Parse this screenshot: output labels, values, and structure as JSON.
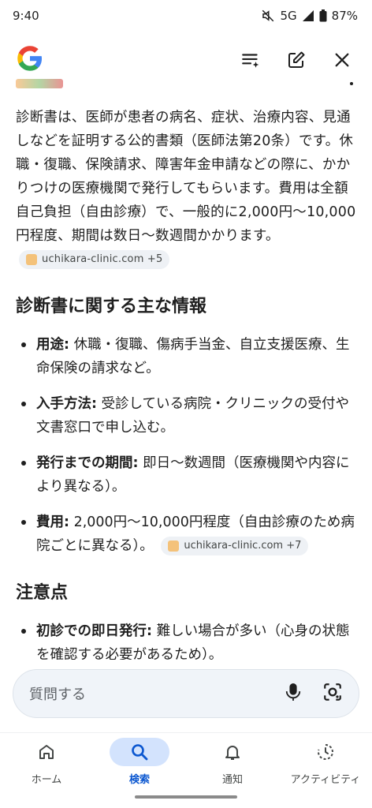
{
  "status": {
    "time": "9:40",
    "network": "5G",
    "battery": "87%"
  },
  "app": {
    "logo": "G"
  },
  "answer": {
    "intro": "診断書は、医師が患者の病名、症状、治療内容、見通しなどを証明する公的書類（医師法第20条）です。休職・復職、保険請求、障害年金申請などの際に、かかりつけの医療機関で発行してもらいます。費用は全額自己負担（自由診療）で、一般的に2,000円〜10,000円程度、期間は数日〜数週間かかります。",
    "intro_source": "uchikara-clinic.com +5",
    "section1_title": "診断書に関する主な情報",
    "items1": [
      {
        "term": "用途:",
        "text": " 休職・復職、傷病手当金、自立支援医療、生命保険の請求など。"
      },
      {
        "term": "入手方法:",
        "text": " 受診している病院・クリニックの受付や文書窓口で申し込む。"
      },
      {
        "term": "発行までの期間:",
        "text": " 即日〜数週間（医療機関や内容により異なる）。"
      },
      {
        "term": "費用:",
        "text": " 2,000円〜10,000円程度（自由診療のため病院ごとに異なる）。"
      }
    ],
    "items1_source": "uchikara-clinic.com +7",
    "section2_title": "注意点",
    "items2": [
      {
        "term": "初診での即日発行:",
        "text": " 難しい場合が多い（心身の状態を確認する必要があるため）。"
      }
    ]
  },
  "search": {
    "placeholder": "質問する"
  },
  "nav": [
    {
      "label": "ホーム",
      "icon": "home-icon",
      "active": false
    },
    {
      "label": "検索",
      "icon": "search-icon",
      "active": true
    },
    {
      "label": "通知",
      "icon": "bell-icon",
      "active": false
    },
    {
      "label": "アクティビティ",
      "icon": "activity-icon",
      "active": false
    }
  ],
  "colors": {
    "accent": "#0b57d0",
    "active_pill": "#d3e3fd",
    "chip_bg": "#eef1f5",
    "search_bg": "#f0f4f9"
  }
}
